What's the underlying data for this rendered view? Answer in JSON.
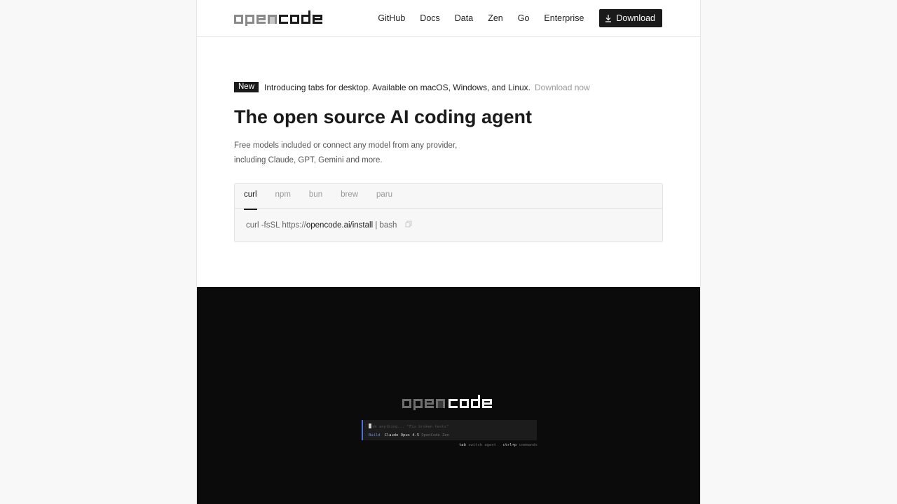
{
  "header": {
    "logo_text": "opencode",
    "nav": [
      "GitHub",
      "Docs",
      "Data",
      "Zen",
      "Go",
      "Enterprise"
    ],
    "download_label": "Download"
  },
  "announcement": {
    "badge": "New",
    "text": "Introducing tabs for desktop. Available on macOS, Windows, and Linux.",
    "link": "Download now"
  },
  "hero": {
    "title": "The open source AI coding agent",
    "subtitle_line1": "Free models included or connect any model from any provider,",
    "subtitle_line2": "including Claude, GPT, Gemini and more."
  },
  "install": {
    "tabs": [
      "curl",
      "npm",
      "bun",
      "brew",
      "paru"
    ],
    "active_tab": "curl",
    "command_prefix": "curl -fsSL https://",
    "command_host": "opencode.ai/install",
    "command_suffix": " | bash"
  },
  "terminal": {
    "logo_text": "opencode",
    "placeholder": "sk anything...  \"Fix broken tests\"",
    "mode": "Build",
    "model": "Claude Opus 4.5",
    "provider": "OpenCode Zen",
    "hint1_key": "tab",
    "hint1_desc": "switch agent",
    "hint2_key": "ctrl+p",
    "hint2_desc": "commands",
    "accent_color": "#4a6fd6"
  },
  "colors": {
    "text": "#1a1a1a",
    "muted": "#9a9a9a",
    "dark_bg": "#0b0b0b"
  }
}
